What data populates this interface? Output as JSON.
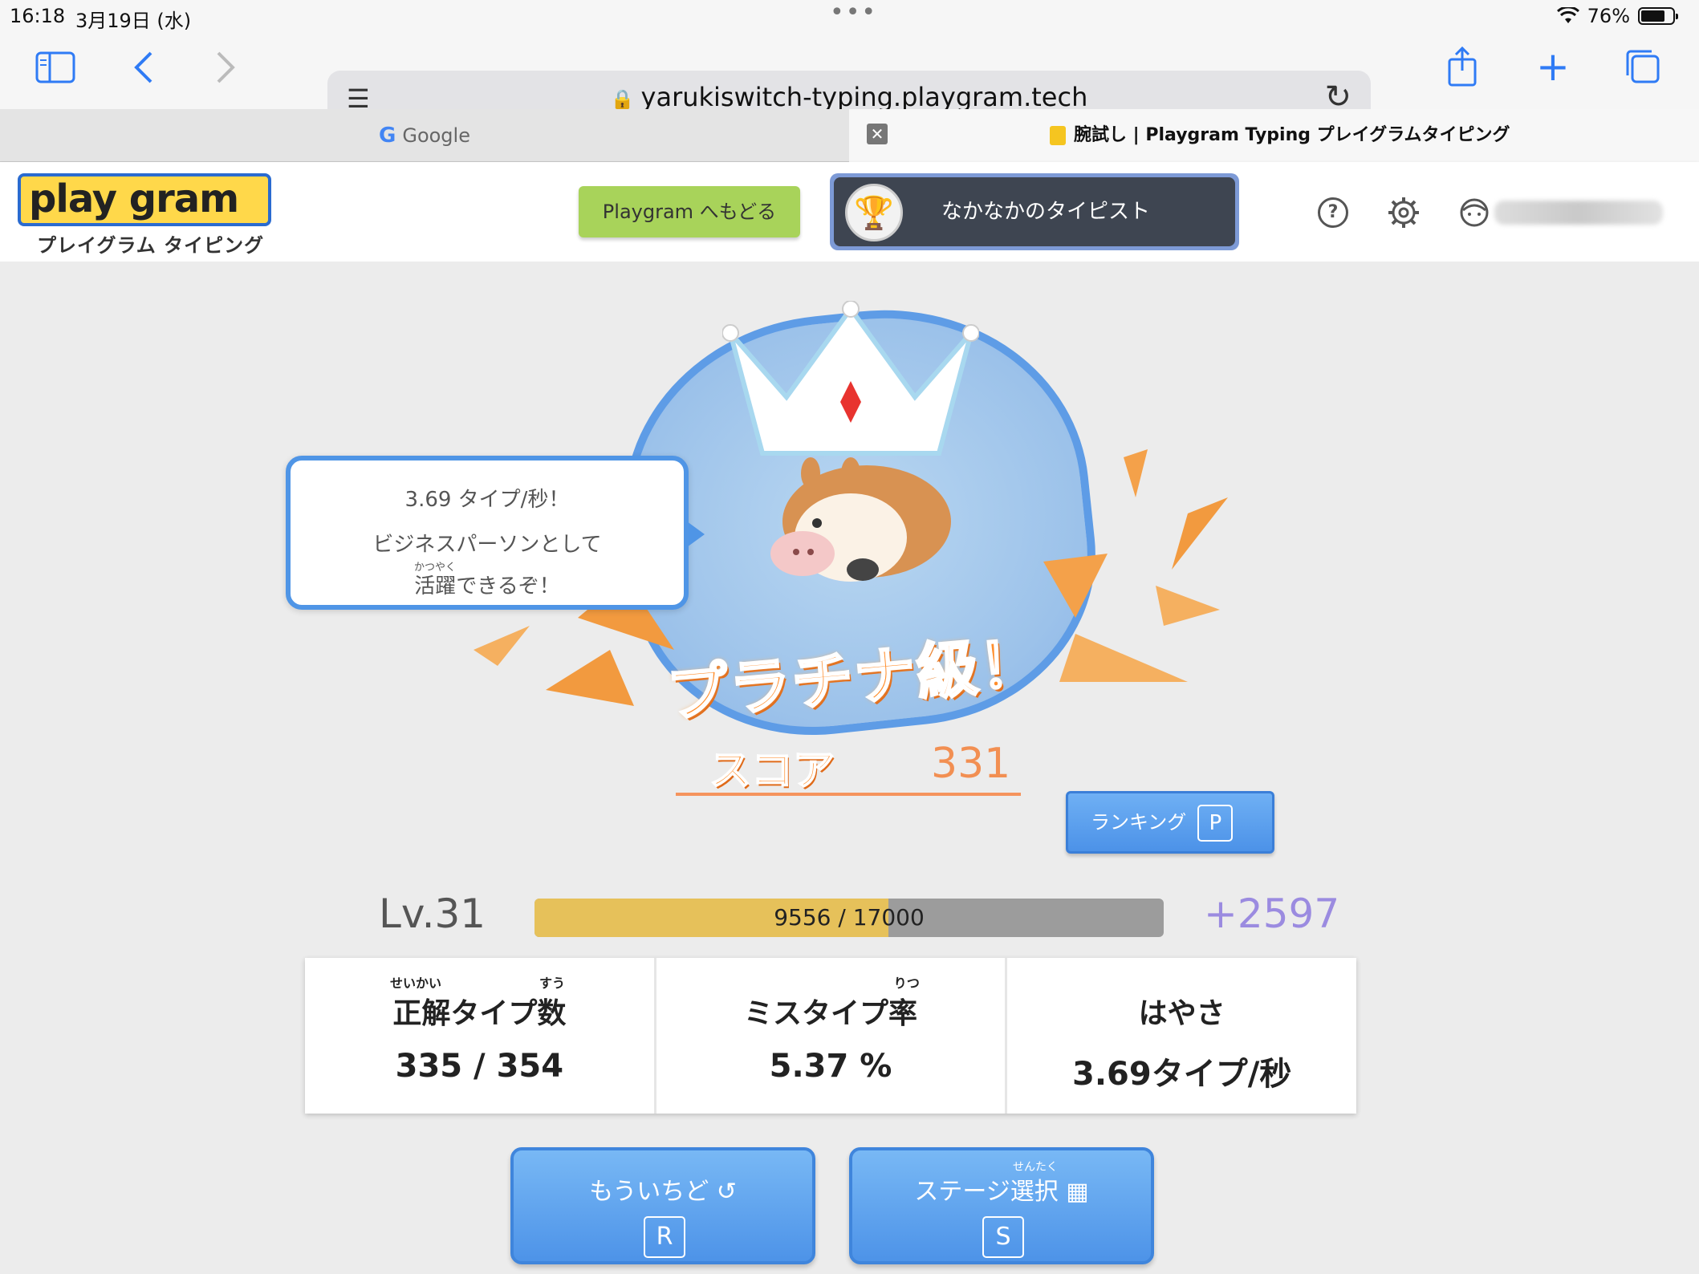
{
  "status_bar": {
    "time": "16:18",
    "date": "3月19日 (水)",
    "dots": "•••",
    "battery_pct": "76%",
    "battery_level": 0.76
  },
  "browser": {
    "url": "yarukiswitch-typing.playgram.tech",
    "tabs": [
      {
        "label": "Google",
        "icon": "google-icon"
      },
      {
        "label": "腕試し | Playgram Typing プレイグラムタイピング",
        "icon": "playgram-favicon",
        "active": true
      }
    ]
  },
  "site_header": {
    "logo_text": "play gram",
    "logo_sub": "プレイグラム タイピング",
    "back_button": "Playgram へもどる",
    "title_badge": "なかなかのタイピスト"
  },
  "result": {
    "speech": {
      "line1": "3.69 タイプ/秒！",
      "line2": "ビジネスパーソンとして",
      "ruby": "かつやく",
      "line3": "活躍できるぞ！"
    },
    "rank_title": "プラチナ級！",
    "score_label": "スコア",
    "score_value": "331",
    "ranking_button": {
      "label": "ランキング",
      "key": "P"
    },
    "level": {
      "label": "Lv.31",
      "current": 9556,
      "max": 17000,
      "text": "9556 / 17000",
      "gain": "+2597"
    },
    "stats": [
      {
        "title": "正解タイプ数",
        "ruby_a": "せいかい",
        "ruby_b": "すう",
        "value": "335 / 354"
      },
      {
        "title": "ミスタイプ率",
        "ruby_a": "りつ",
        "value": "5.37 %"
      },
      {
        "title": "はやさ",
        "value": "3.69タイプ/秒"
      }
    ],
    "retry_button": {
      "label": "もういちど",
      "icon": "retry-icon",
      "key": "R"
    },
    "stage_button": {
      "label": "ステージ選択",
      "ruby": "せんたく",
      "icon": "grid-icon",
      "key": "S"
    }
  },
  "colors": {
    "accent_blue": "#4f95e6",
    "score_orange": "#ff8d2b",
    "level_fill": "#e6c15a",
    "back_green": "#a8d35a"
  }
}
